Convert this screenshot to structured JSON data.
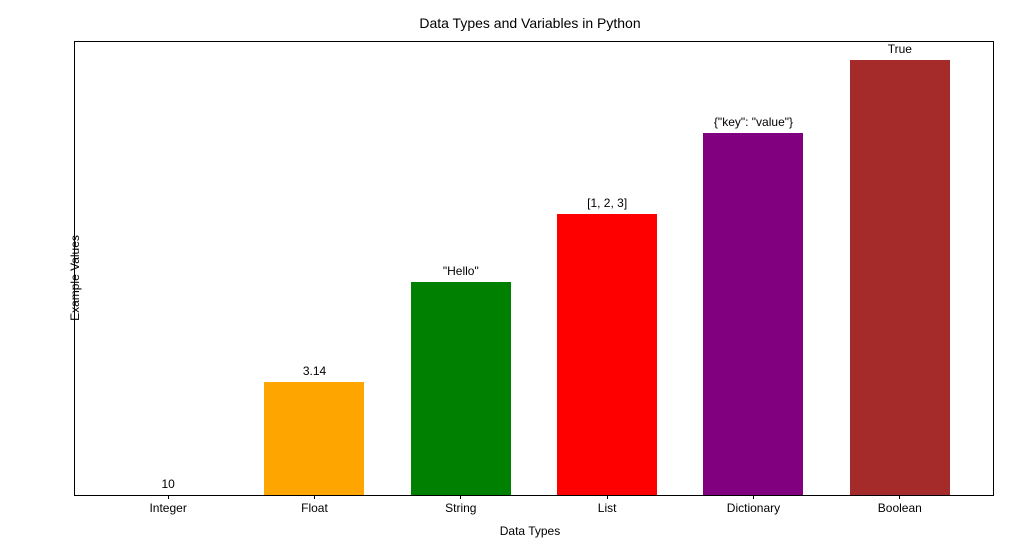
{
  "chart_data": {
    "type": "bar",
    "title": "Data Types and Variables in Python",
    "xlabel": "Data Types",
    "ylabel": "Example Values",
    "categories": [
      "Integer",
      "Float",
      "String",
      "List",
      "Dictionary",
      "Boolean"
    ],
    "bar_labels": [
      "10",
      "3.14",
      "\"Hello\"",
      "[1, 2, 3]",
      "{\"key\": \"value\"}",
      "True"
    ],
    "values": [
      0,
      25,
      47,
      62,
      80,
      97
    ],
    "colors": [
      "#1f77b4",
      "#ffa500",
      "#008000",
      "#ff0000",
      "#800080",
      "#a52a2a"
    ],
    "ylim": [
      0,
      100
    ]
  }
}
